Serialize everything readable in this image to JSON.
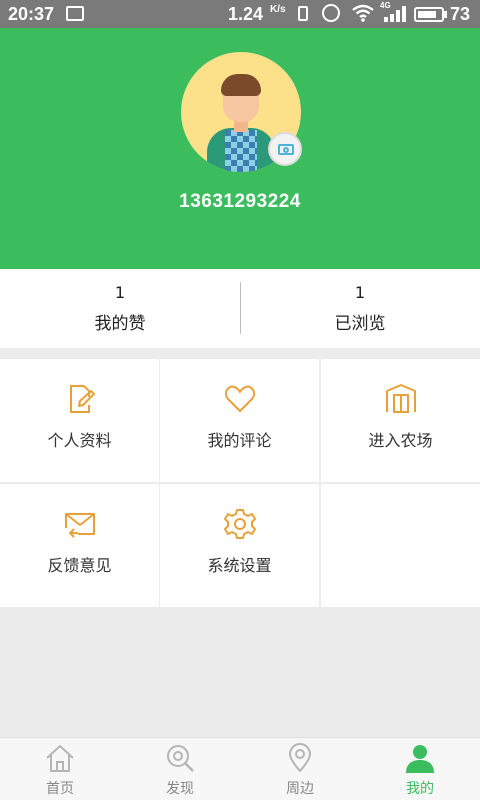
{
  "status_bar": {
    "time": "20:37",
    "speed": "1.24",
    "speed_unit": "K/s",
    "network": "4G",
    "battery_level": "73"
  },
  "profile": {
    "phone": "13631293224"
  },
  "stats": [
    {
      "count": "1",
      "label": "我的赞"
    },
    {
      "count": "1",
      "label": "已浏览"
    }
  ],
  "menu": [
    {
      "label": "个人资料",
      "icon": "edit-icon"
    },
    {
      "label": "我的评论",
      "icon": "heart-icon"
    },
    {
      "label": "进入农场",
      "icon": "farm-door-icon"
    },
    {
      "label": "反馈意见",
      "icon": "mail-icon"
    },
    {
      "label": "系统设置",
      "icon": "settings-icon"
    }
  ],
  "tabs": [
    {
      "label": "首页",
      "icon": "home-icon"
    },
    {
      "label": "发现",
      "icon": "discover-icon"
    },
    {
      "label": "周边",
      "icon": "location-icon"
    },
    {
      "label": "我的",
      "icon": "user-icon",
      "active": true
    }
  ],
  "colors": {
    "brand_green": "#3bbd5e",
    "menu_icon_orange": "#e8a13a",
    "tab_inactive": "#b5b5b5"
  }
}
